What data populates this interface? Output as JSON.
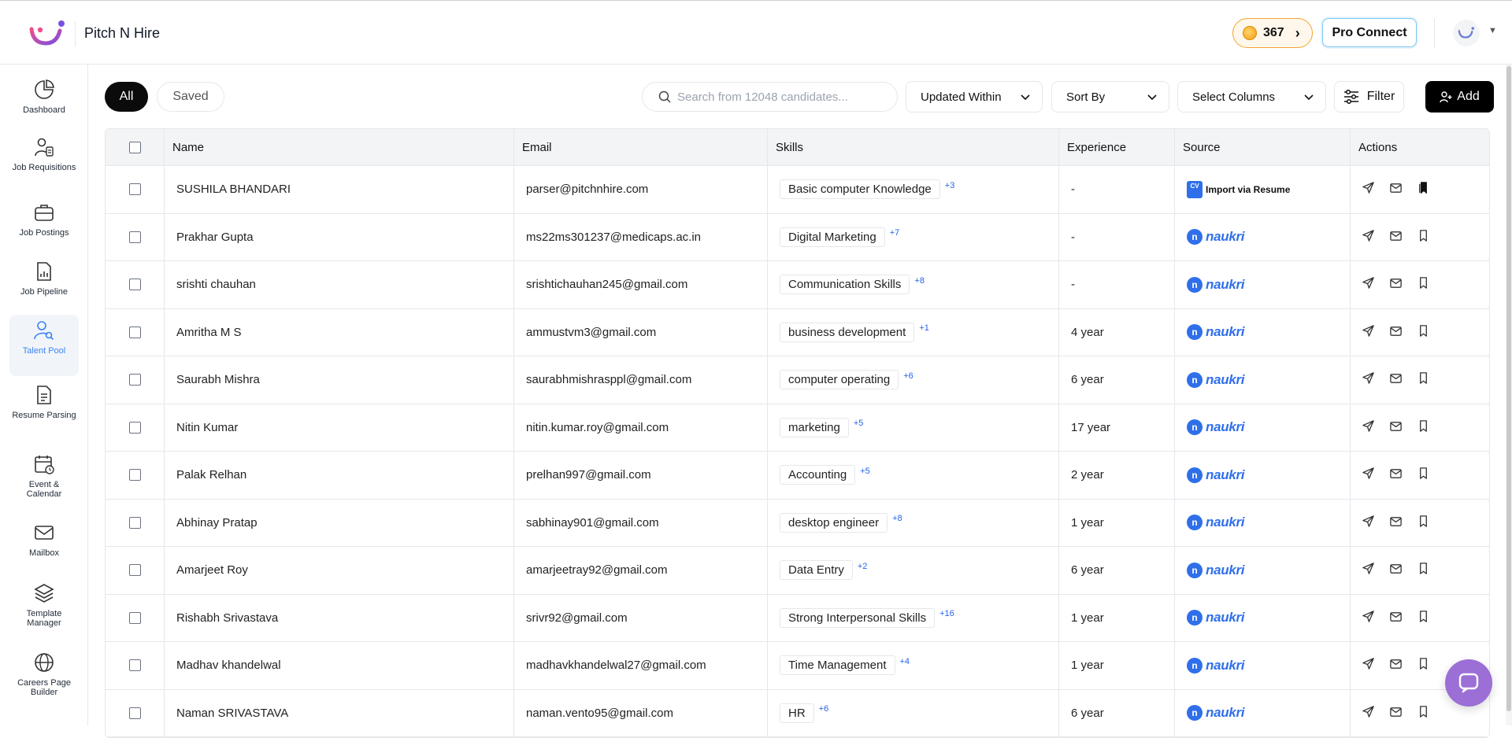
{
  "app": {
    "title": "Pitch N Hire"
  },
  "header": {
    "coins": "367",
    "pro_connect": "Pro Connect"
  },
  "sidebar": {
    "items": [
      {
        "label": "Dashboard",
        "icon": "pie-chart-icon"
      },
      {
        "label": "Job Requisitions",
        "icon": "user-document-icon"
      },
      {
        "label": "Job Postings",
        "icon": "briefcase-icon"
      },
      {
        "label": "Job Pipeline",
        "icon": "report-chart-icon"
      },
      {
        "label": "Talent Pool",
        "icon": "user-search-icon",
        "active": true
      },
      {
        "label": "Resume Parsing",
        "icon": "document-lines-icon"
      },
      {
        "label": "Event & Calendar",
        "icon": "calendar-icon"
      },
      {
        "label": "Mailbox",
        "icon": "mail-icon"
      },
      {
        "label": "Template Manager",
        "icon": "layers-icon"
      },
      {
        "label": "Careers Page Builder",
        "icon": "globe-icon"
      }
    ]
  },
  "toolbar": {
    "tab_all": "All",
    "tab_saved": "Saved",
    "search_placeholder": "Search from 12048 candidates...",
    "updated_within": "Updated Within",
    "sort_by": "Sort By",
    "select_columns": "Select Columns",
    "filter": "Filter",
    "add": "Add"
  },
  "table": {
    "columns": [
      "Name",
      "Email",
      "Skills",
      "Experience",
      "Source",
      "Actions"
    ],
    "rows": [
      {
        "name": "SUSHILA BHANDARI",
        "email": "parser@pitchnhire.com",
        "skill": "Basic computer Knowledge",
        "more": "+3",
        "experience": "-",
        "source": "Import via Resume",
        "saved": true
      },
      {
        "name": "Prakhar Gupta",
        "email": "ms22ms301237@medicaps.ac.in",
        "skill": "Digital Marketing",
        "more": "+7",
        "experience": "-",
        "source": "naukri"
      },
      {
        "name": "srishti chauhan",
        "email": "srishtichauhan245@gmail.com",
        "skill": "Communication Skills",
        "more": "+8",
        "experience": "-",
        "source": "naukri"
      },
      {
        "name": "Amritha M S",
        "email": "ammustvm3@gmail.com",
        "skill": "business development",
        "more": "+1",
        "experience": "4 year",
        "source": "naukri"
      },
      {
        "name": "Saurabh Mishra",
        "email": "saurabhmishrasppl@gmail.com",
        "skill": "computer operating",
        "more": "+6",
        "experience": "6 year",
        "source": "naukri"
      },
      {
        "name": "Nitin Kumar",
        "email": "nitin.kumar.roy@gmail.com",
        "skill": "marketing",
        "more": "+5",
        "experience": "17 year",
        "source": "naukri"
      },
      {
        "name": "Palak Relhan",
        "email": "prelhan997@gmail.com",
        "skill": "Accounting",
        "more": "+5",
        "experience": "2 year",
        "source": "naukri"
      },
      {
        "name": "Abhinay Pratap",
        "email": "sabhinay901@gmail.com",
        "skill": "desktop engineer",
        "more": "+8",
        "experience": "1 year",
        "source": "naukri"
      },
      {
        "name": "Amarjeet Roy",
        "email": "amarjeetray92@gmail.com",
        "skill": "Data Entry",
        "more": "+2",
        "experience": "6 year",
        "source": "naukri"
      },
      {
        "name": "Rishabh Srivastava",
        "email": "srivr92@gmail.com",
        "skill": "Strong Interpersonal Skills",
        "more": "+16",
        "experience": "1 year",
        "source": "naukri"
      },
      {
        "name": "Madhav khandelwal",
        "email": "madhavkhandelwal27@gmail.com",
        "skill": "Time Management",
        "more": "+4",
        "experience": "1 year",
        "source": "naukri"
      },
      {
        "name": "Naman SRIVASTAVA",
        "email": "naman.vento95@gmail.com",
        "skill": "HR",
        "more": "+6",
        "experience": "6 year",
        "source": "naukri"
      }
    ]
  },
  "colors": {
    "accent": "#3b82f6",
    "naukri": "#2f6fea",
    "coin_border": "#f4a431",
    "chat": "#9b6fd6"
  }
}
